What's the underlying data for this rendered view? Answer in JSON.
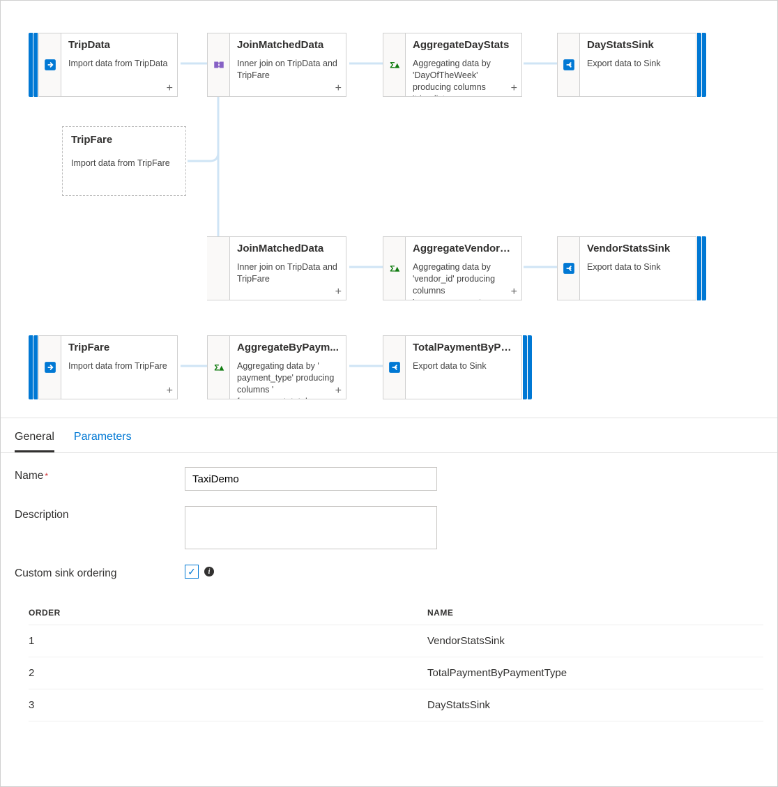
{
  "nodes": {
    "tripdata": {
      "title": "TripData",
      "desc": "Import data from TripData"
    },
    "tripfare_ghost": {
      "title": "TripFare",
      "desc": "Import data from TripFare"
    },
    "join1": {
      "title": "JoinMatchedData",
      "desc": "Inner join on TripData and TripFare"
    },
    "aggday": {
      "title": "AggregateDayStats",
      "desc": "Aggregating data by 'DayOfTheWeek' producing columns 'trip_distance…"
    },
    "daysink": {
      "title": "DayStatsSink",
      "desc": "Export data to Sink"
    },
    "join2": {
      "title": "JoinMatchedData",
      "desc": "Inner join on TripData and TripFare"
    },
    "aggvendor": {
      "title": "AggregateVendorS...",
      "desc": "Aggregating data by 'vendor_id' producing columns 'passenger_count…"
    },
    "vendorsink": {
      "title": "VendorStatsSink",
      "desc": "Export data to Sink"
    },
    "tripfare2": {
      "title": "TripFare",
      "desc": "Import data from TripFare"
    },
    "aggpay": {
      "title": "AggregateByPaym...",
      "desc": "Aggregating data by ' payment_type' producing columns ' fare_amount_total…"
    },
    "paysink": {
      "title": "TotalPaymentByPa...",
      "desc": "Export data to Sink"
    }
  },
  "tabs": {
    "general": "General",
    "parameters": "Parameters"
  },
  "form": {
    "name_label": "Name",
    "name_value": "TaxiDemo",
    "desc_label": "Description",
    "desc_value": "",
    "custom_label": "Custom sink ordering"
  },
  "table": {
    "col_order": "Order",
    "col_name": "Name",
    "rows": [
      {
        "order": "1",
        "name": "VendorStatsSink"
      },
      {
        "order": "2",
        "name": "TotalPaymentByPaymentType"
      },
      {
        "order": "3",
        "name": "DayStatsSink"
      }
    ]
  }
}
